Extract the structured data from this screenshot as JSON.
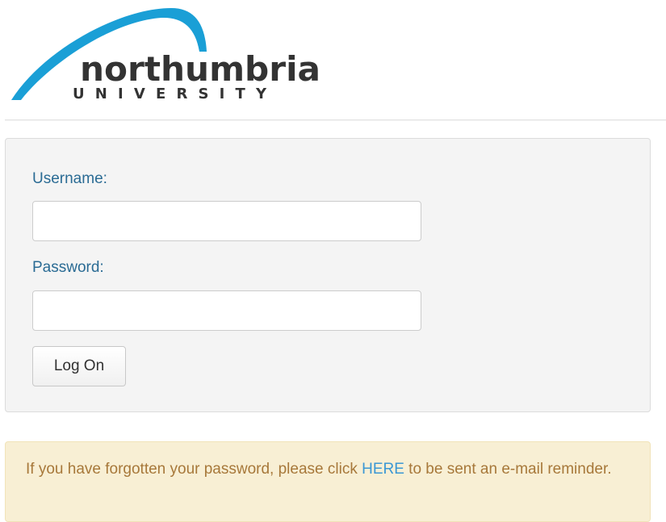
{
  "logo": {
    "name": "northumbria",
    "subtitle": "UNIVERSITY",
    "arc_color": "#1a9fd6",
    "text_color": "#333333"
  },
  "login_form": {
    "username_label": "Username:",
    "username_value": "",
    "password_label": "Password:",
    "password_value": "",
    "submit_label": "Log On"
  },
  "forgot_notice": {
    "text_before": "If you have forgotten your password, please click ",
    "link_text": "HERE",
    "text_after": " to be sent an e-mail reminder."
  },
  "colors": {
    "label": "#2a6b94",
    "link": "#3a97d4",
    "notice_text": "#a7783a",
    "notice_bg": "#f8efd4",
    "panel_bg": "#f4f4f4"
  }
}
